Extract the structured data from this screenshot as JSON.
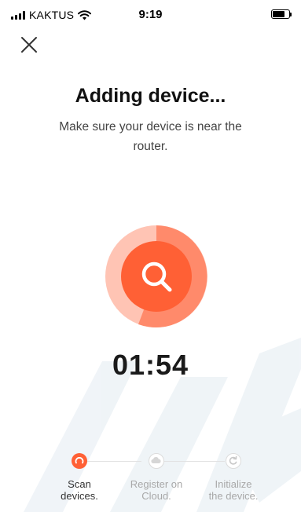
{
  "status_bar": {
    "carrier": "KAKTUS",
    "time": "9:19"
  },
  "icons": {
    "close": "close-icon",
    "search": "search-icon",
    "wifi": "wifi-icon",
    "battery": "battery-icon"
  },
  "header": {
    "title": "Adding device...",
    "subtitle": "Make sure your device is near the router."
  },
  "scan": {
    "timer": "01:54"
  },
  "steps": [
    {
      "label": "Scan devices.",
      "active": true
    },
    {
      "label": "Register on Cloud.",
      "active": false
    },
    {
      "label": "Initialize the device.",
      "active": false
    }
  ],
  "colors": {
    "accent": "#ff6035",
    "accent_light": "#ffd6cc",
    "accent_mid": "#ff9b80",
    "inactive": "#d9d9d9",
    "inactive_text": "#a8a8a8",
    "active_text": "#333333"
  }
}
